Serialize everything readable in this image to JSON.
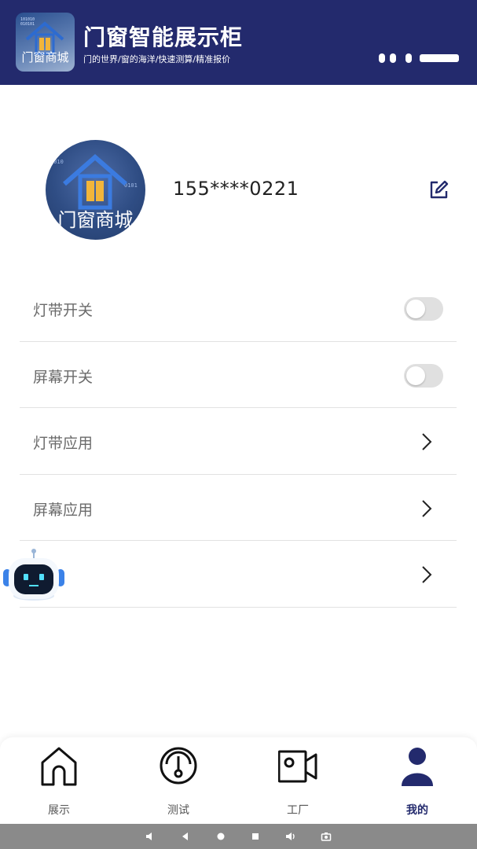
{
  "header": {
    "logo_text": "门窗商城",
    "title": "门窗智能展示柜",
    "subtitle": "门的世界/窗的海洋/快速测算/精准报价"
  },
  "profile": {
    "avatar_text": "门窗商城",
    "phone": "155****0221"
  },
  "menu": [
    {
      "label": "灯带开关",
      "control": "toggle",
      "on": false
    },
    {
      "label": "屏幕开关",
      "control": "toggle",
      "on": false
    },
    {
      "label": "灯带应用",
      "control": "chevron"
    },
    {
      "label": "屏幕应用",
      "control": "chevron"
    },
    {
      "label": "",
      "control": "chevron"
    }
  ],
  "bottom_nav": [
    {
      "label": "展示",
      "icon": "home-icon",
      "active": false
    },
    {
      "label": "测试",
      "icon": "gauge-icon",
      "active": false
    },
    {
      "label": "工厂",
      "icon": "video-camera-icon",
      "active": false
    },
    {
      "label": "我的",
      "icon": "user-icon",
      "active": true
    }
  ],
  "colors": {
    "primary": "#232a6d",
    "toggle_off": "#e0e0e0",
    "divider": "#e2e2e2",
    "system_bar": "#8a8a8a"
  }
}
